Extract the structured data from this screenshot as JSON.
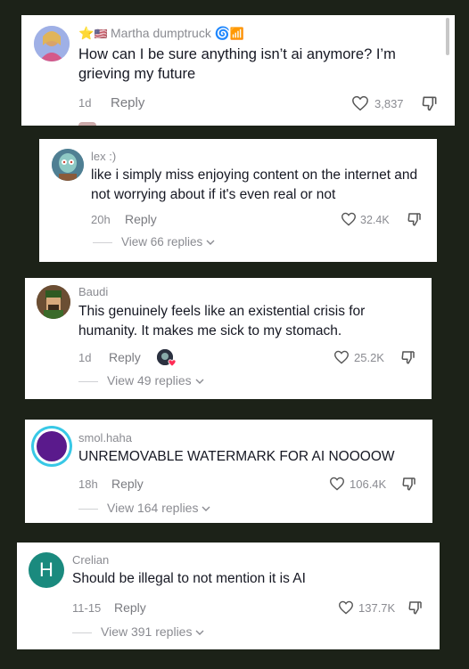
{
  "comments": [
    {
      "username": "Martha dumptruck",
      "text": "How can I be sure anything isn’t ai anymore? I’m grieving my future",
      "time": "1d",
      "reply_label": "Reply",
      "likes": "3,837",
      "avatar_color": "#a6b3e6"
    },
    {
      "username": "lex :)",
      "text": "like i simply miss enjoying content on the internet and not worrying about if it's even real or not",
      "time": "20h",
      "reply_label": "Reply",
      "likes": "32.4K",
      "view_replies": "View 66 replies",
      "avatar_color": "#5d93a3"
    },
    {
      "username": "Baudi",
      "text": "This genuinely feels like an existential crisis for humanity. It makes me sick to my stomach.",
      "time": "1d",
      "reply_label": "Reply",
      "likes": "25.2K",
      "view_replies": "View 49 replies",
      "avatar_color": "#7b5a3c"
    },
    {
      "username": "smol.haha",
      "text": "UNREMOVABLE WATERMARK FOR AI NOOOOW",
      "time": "18h",
      "reply_label": "Reply",
      "likes": "106.4K",
      "view_replies": "View 164 replies",
      "avatar_color": "#5a1a8c"
    },
    {
      "username": "Crelian",
      "avatar_letter": "H",
      "text": "Should be illegal to not mention it is AI",
      "time": "11-15",
      "reply_label": "Reply",
      "likes": "137.7K",
      "view_replies": "View 391 replies",
      "avatar_color": "#1a8a7e"
    }
  ],
  "badges": {
    "star": "⭐",
    "flag": "🇺🇸",
    "swirl": "🌀",
    "chart": "📶"
  },
  "icons": {
    "like": "heart-outline-icon",
    "dislike": "thumbs-down-icon",
    "expand": "chevron-down-icon"
  }
}
